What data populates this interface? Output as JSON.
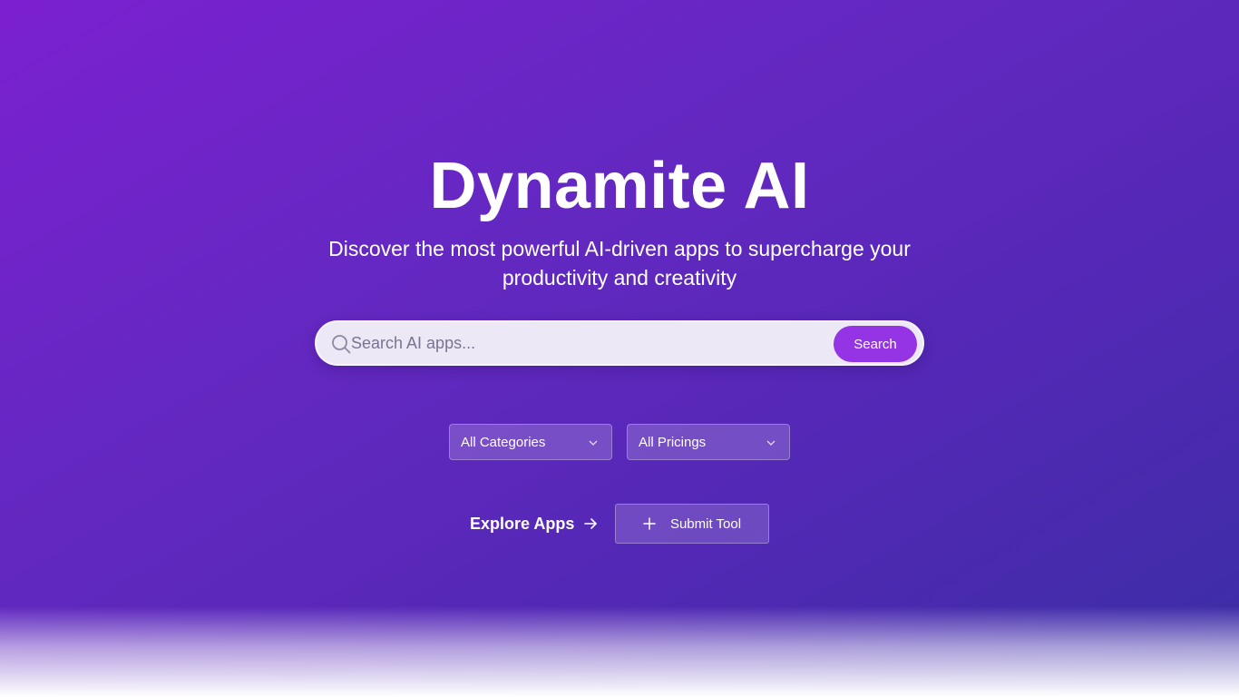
{
  "hero": {
    "title": "Dynamite AI",
    "subtitle": "Discover the most powerful AI-driven apps to supercharge your productivity and creativity"
  },
  "search": {
    "placeholder": "Search AI apps...",
    "button_label": "Search",
    "icon": "search-icon"
  },
  "filters": {
    "categories": {
      "selected": "All Categories",
      "icon": "chevron-down-icon"
    },
    "pricings": {
      "selected": "All Pricings",
      "icon": "chevron-down-icon"
    }
  },
  "actions": {
    "explore_label": "Explore Apps",
    "explore_icon": "arrow-right-icon",
    "submit_label": "Submit Tool",
    "submit_icon": "plus-icon"
  },
  "colors": {
    "gradient_start": "#7b20d0",
    "gradient_end": "#3a2ea4",
    "search_button": "#9434e4",
    "search_bar_bg": "#ece8f6"
  }
}
